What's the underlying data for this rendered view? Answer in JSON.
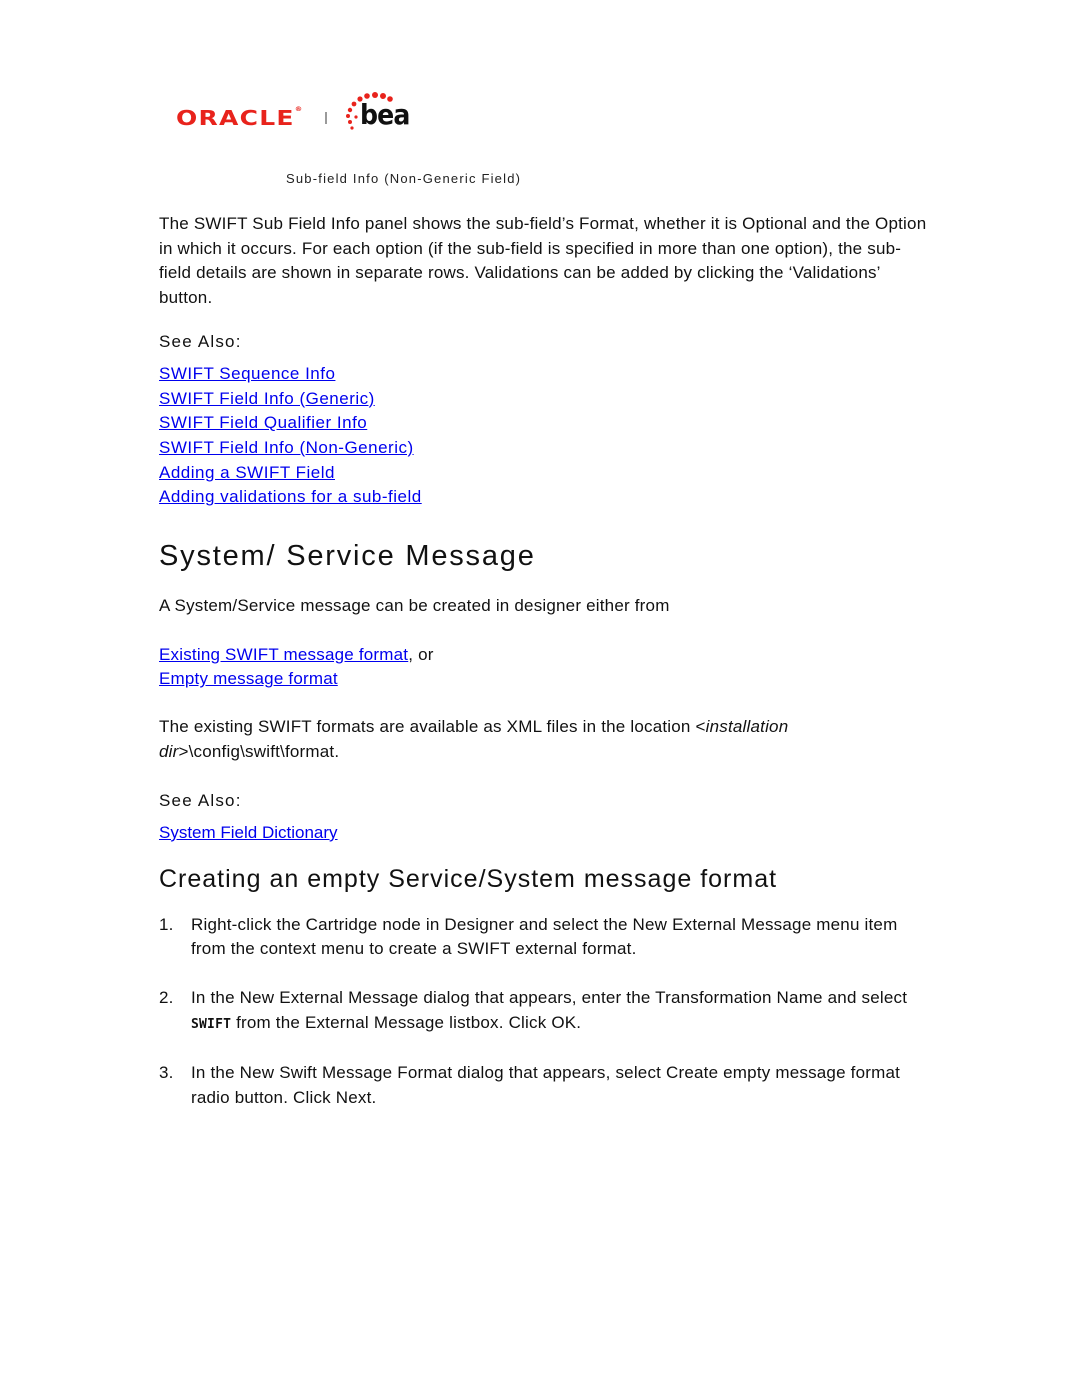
{
  "header": {
    "logo_oracle": "ORACLE",
    "logo_bea": "bea",
    "caption": "Sub-field Info (Non-Generic Field)"
  },
  "section1": {
    "paragraph": {
      "t1": "The SWIFT Sub Field Info panel shows the sub-field’s Format, whether it is Optional and the Option in which it occurs. For each option (if the sub-field is specified in more than one option), the sub-field details are shown in separate rows. Validations can be added by clicking the ‘Validations’ button."
    },
    "see_also_label": "See Also:",
    "links": [
      "SWIFT Sequence Info",
      "SWIFT Field Info (Generic)",
      "SWIFT Field Qualifier Info",
      "SWIFT Field Info (Non-Generic)",
      "Adding a SWIFT Field",
      "Adding validations for a sub-field"
    ]
  },
  "section2": {
    "heading": "System/ Service Message",
    "intro": "A System/Service message can be created in designer either from",
    "option_link_1": "Existing SWIFT message format",
    "option_suffix_1": ", or",
    "option_link_2": "Empty message format",
    "existing_text_1": "The existing SWIFT formats are available as XML files in the location <",
    "existing_italic_1": "installation dir",
    "existing_text_2": ">\\config\\swift\\format.",
    "see_also_label": "See Also:",
    "see_also_link": "System Field Dictionary"
  },
  "section3": {
    "heading": "Creating an empty Service/System message format",
    "steps": [
      {
        "num": "1.",
        "text": "Right-click the Cartridge node in Designer and select the New External Message menu item from the context menu to create a SWIFT external format."
      },
      {
        "num": "2.",
        "pre": "In the New External Message dialog that appears, enter the Transformation Name and select ",
        "code": "SWIFT",
        "post": " from the External Message listbox.  Click OK."
      },
      {
        "num": "3.",
        "text": "In the New Swift Message Format dialog that appears, select Create empty message format radio button.  Click Next."
      }
    ]
  }
}
